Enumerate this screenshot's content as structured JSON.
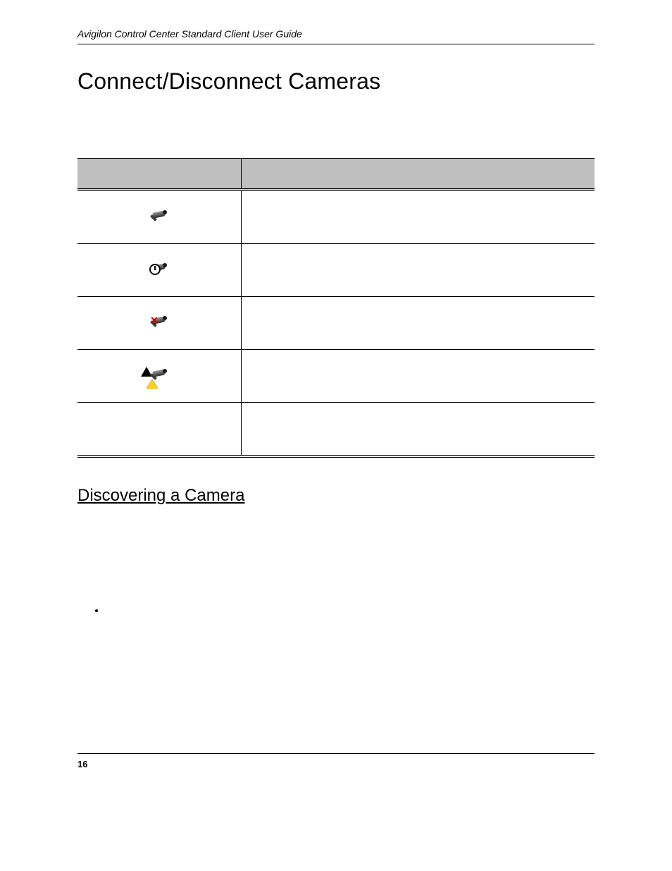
{
  "running_header": "Avigilon Control Center Standard Client User Guide",
  "section_heading": "Connect/Disconnect Cameras",
  "table": {
    "header": {
      "col_icon": "",
      "col_desc": ""
    },
    "rows": [
      {
        "icon": "camera",
        "desc": ""
      },
      {
        "icon": "camera-clock",
        "desc": ""
      },
      {
        "icon": "camera-x",
        "desc": ""
      },
      {
        "icon": "camera-warning",
        "desc": ""
      },
      {
        "icon": "",
        "desc": ""
      }
    ]
  },
  "sub_heading": "Discovering a Camera",
  "bullets": [
    ""
  ],
  "page_number": "16"
}
